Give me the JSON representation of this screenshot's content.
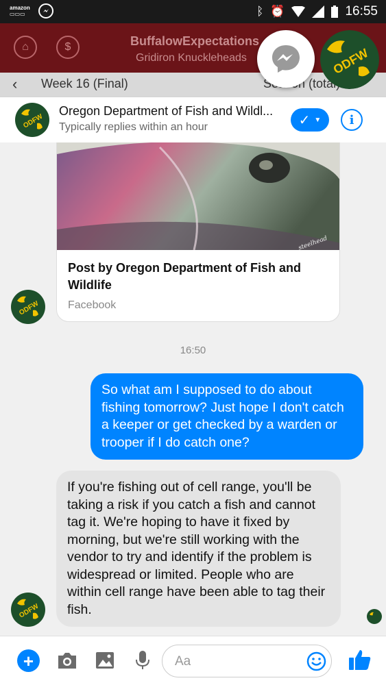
{
  "status_bar": {
    "amazon_label": "amazon",
    "time": "16:55"
  },
  "background_app": {
    "title": "BuffalowExpectations",
    "subtitle": "Gridiron Knuckleheads",
    "week_label": "Week 16 (Final)",
    "season_label": "Season (total)"
  },
  "header": {
    "name": "Oregon Department of Fish and Wildl...",
    "status": "Typically replies within an hour",
    "logo_text": "ODFW"
  },
  "post_card": {
    "image_caption": "steelhead",
    "title": "Post by Oregon Department of Fish and Wildlife",
    "source": "Facebook"
  },
  "timestamp": "16:50",
  "messages": [
    {
      "from": "me",
      "text": "So what am I supposed to do about fishing tomorrow?  Just hope I don't catch a keeper or get checked by a warden or trooper if I do catch one?"
    },
    {
      "from": "odfw",
      "text": "If you're fishing out of cell range, you'll be taking a risk if you catch a fish and cannot tag it. We're hoping to have it fixed by morning, but we're still working with the vendor to try and identify if the problem is widespread or limited. People who are within cell range have been able to tag their fish."
    }
  ],
  "composer": {
    "placeholder": "Aa"
  },
  "colors": {
    "accent": "#0084ff",
    "odfw_green": "#1d4f2a",
    "odfw_yellow": "#f2c300"
  }
}
